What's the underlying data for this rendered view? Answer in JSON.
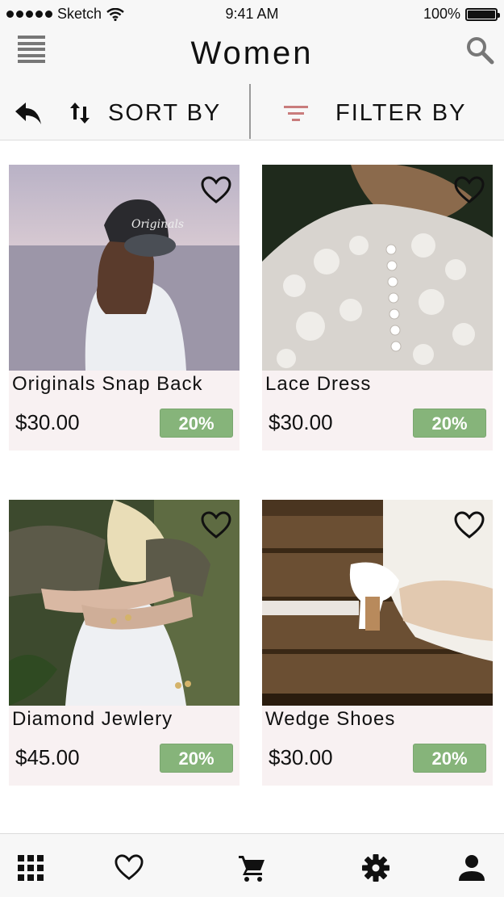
{
  "status_bar": {
    "carrier": "Sketch",
    "time": "9:41 AM",
    "battery": "100%"
  },
  "header": {
    "title": "Women",
    "menu_icon": "hamburger-menu-icon",
    "search_icon": "search-icon"
  },
  "toolbar": {
    "back_icon": "reply-arrow-icon",
    "sort_icon": "sort-arrows-icon",
    "sort_label": "SORT BY",
    "filter_icon": "filter-lines-icon",
    "filter_label": "FILTER BY",
    "filter_icon_color": "#c97c7c"
  },
  "products": [
    {
      "name": "Originals Snap Back",
      "price": "$30.00",
      "discount": "20%"
    },
    {
      "name": "Lace Dress",
      "price": "$30.00",
      "discount": "20%"
    },
    {
      "name": "Diamond Jewlery",
      "price": "$45.00",
      "discount": "20%"
    },
    {
      "name": "Wedge Shoes",
      "price": "$30.00",
      "discount": "20%"
    }
  ],
  "colors": {
    "discount_badge": "#86b47a",
    "card_background": "#f8f1f2",
    "bar_background": "#f7f7f7"
  },
  "bottom_nav": [
    {
      "icon": "grid-icon"
    },
    {
      "icon": "heart-icon"
    },
    {
      "icon": "cart-icon"
    },
    {
      "icon": "gear-icon"
    },
    {
      "icon": "profile-icon"
    }
  ]
}
